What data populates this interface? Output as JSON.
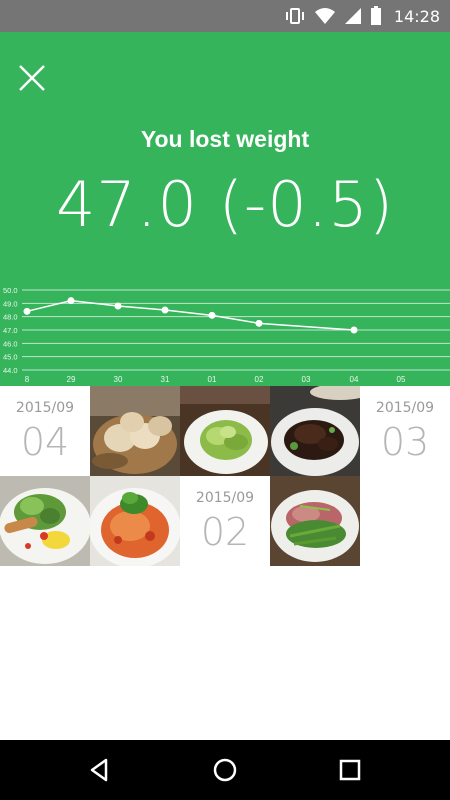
{
  "status_bar": {
    "time": "14:28"
  },
  "summary": {
    "headline": "You lost weight",
    "weight_text": "47.0 (-0.5)"
  },
  "chart_data": {
    "type": "line",
    "y_ticks": [
      "50.0",
      "49.0",
      "48.0",
      "47.0",
      "46.0",
      "45.0",
      "44.0"
    ],
    "x_ticks": [
      "8",
      "29",
      "30",
      "31",
      "01",
      "02",
      "03",
      "04",
      "05"
    ],
    "ylim": [
      44.0,
      50.0
    ],
    "grid": true,
    "series": [
      {
        "x": [
          "28",
          "29",
          "30",
          "31",
          "01",
          "02",
          "04"
        ],
        "values": [
          48.4,
          49.2,
          48.8,
          48.5,
          48.1,
          47.5,
          47.0
        ]
      }
    ]
  },
  "dates": [
    {
      "ym": "2015/09",
      "day": "04"
    },
    {
      "ym": "2015/09",
      "day": "03"
    },
    {
      "ym": "2015/09",
      "day": "02"
    }
  ],
  "photos": [
    "bread-photo",
    "salad-photo",
    "braised-meat-photo",
    "salad-sausage-photo",
    "pasta-photo",
    "steak-salad-photo"
  ],
  "colors": {
    "header_green": "#36b45c",
    "status_gray": "#757575",
    "date_gray": "#b5b5b5"
  }
}
